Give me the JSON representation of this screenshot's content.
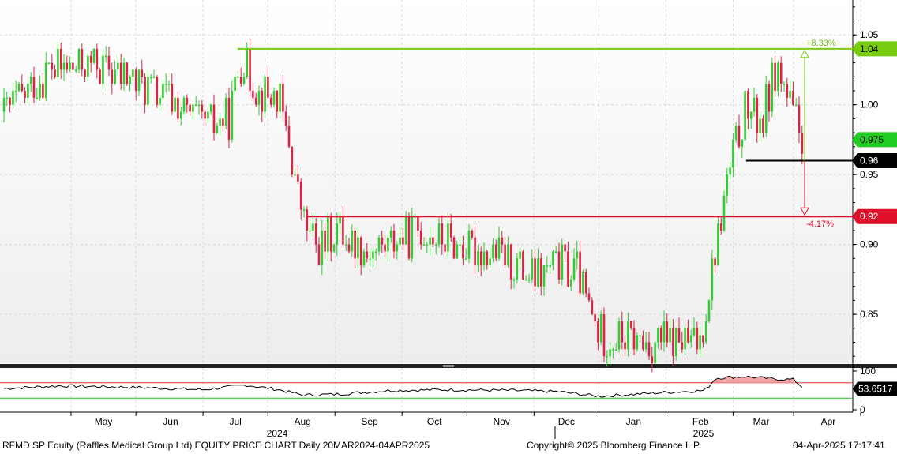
{
  "footer": {
    "left": "RFMD SP Equity (Raffles Medical Group Ltd) EQUITY PRICE CHART  Daily 20MAR2024-04APR2025",
    "center": "Copyright© 2025 Bloomberg Finance L.P.",
    "right": "04-Apr-2025 17:17:41"
  },
  "colors": {
    "up": "#33cc33",
    "down": "#dd2244",
    "high_line": "#77cc11",
    "low_line": "#dd1133",
    "last_line": "#000000",
    "rsi_line": "#000000",
    "rsi_upper": "#dd3333",
    "rsi_lower": "#22bb22",
    "rsi_fill": "#f4a6a6"
  },
  "chart_data": [
    {
      "type": "candlestick",
      "title": "",
      "date_range": [
        "2024-03-20",
        "2025-04-04"
      ],
      "x_month_labels": [
        "May",
        "Jun",
        "Jul",
        "Aug",
        "Sep",
        "Oct",
        "Nov",
        "Dec",
        "Jan",
        "Feb",
        "Mar",
        "Apr"
      ],
      "x_year_labels": [
        "2024",
        "2025"
      ],
      "y_ticks": [
        0.85,
        0.9,
        0.95,
        1.0,
        1.05
      ],
      "ylim": [
        0.815,
        1.075
      ],
      "price_path": [
        [
          "2024-03-20",
          0.995
        ],
        [
          "2024-04-10",
          1.025
        ],
        [
          "2024-05-01",
          1.03
        ],
        [
          "2024-05-20",
          1.015
        ],
        [
          "2024-06-05",
          1.005
        ],
        [
          "2024-06-20",
          0.985
        ],
        [
          "2024-07-02",
          0.99
        ],
        [
          "2024-07-08",
          1.035
        ],
        [
          "2024-07-15",
          1.01
        ],
        [
          "2024-07-25",
          1.005
        ],
        [
          "2024-07-30",
          0.97
        ],
        [
          "2024-08-05",
          0.92
        ],
        [
          "2024-08-12",
          0.895
        ],
        [
          "2024-08-20",
          0.91
        ],
        [
          "2024-09-05",
          0.895
        ],
        [
          "2024-09-20",
          0.905
        ],
        [
          "2024-10-01",
          0.91
        ],
        [
          "2024-10-15",
          0.9
        ],
        [
          "2024-11-01",
          0.895
        ],
        [
          "2024-11-20",
          0.875
        ],
        [
          "2024-12-02",
          0.885
        ],
        [
          "2024-12-10",
          0.88
        ],
        [
          "2024-12-20",
          0.835
        ],
        [
          "2025-01-10",
          0.83
        ],
        [
          "2025-02-05",
          0.83
        ],
        [
          "2025-02-10",
          0.88
        ],
        [
          "2025-02-18",
          0.95
        ],
        [
          "2025-02-25",
          0.995
        ],
        [
          "2025-03-06",
          0.99
        ],
        [
          "2025-03-12",
          1.03
        ],
        [
          "2025-03-20",
          0.99
        ],
        [
          "2025-03-25",
          0.975
        ]
      ],
      "levels": [
        {
          "label": "1.04",
          "value": 1.04,
          "type": "high",
          "pct": "+8.33%"
        },
        {
          "label": "0.975",
          "value": 0.975,
          "type": "last"
        },
        {
          "label": "0.96",
          "value": 0.96,
          "type": "reference"
        },
        {
          "label": "0.92",
          "value": 0.92,
          "type": "low",
          "pct": "-4.17%"
        }
      ]
    },
    {
      "type": "line",
      "name": "RSI",
      "y_ticks": [
        0,
        100
      ],
      "ylim": [
        0,
        100
      ],
      "thresholds": [
        70,
        30
      ],
      "last_value": "53.6517",
      "series_path": [
        [
          "2024-03-20",
          55
        ],
        [
          "2024-04-15",
          62
        ],
        [
          "2024-05-20",
          58
        ],
        [
          "2024-06-20",
          52
        ],
        [
          "2024-07-10",
          64
        ],
        [
          "2024-07-25",
          52
        ],
        [
          "2024-08-05",
          38
        ],
        [
          "2024-08-20",
          40
        ],
        [
          "2024-09-15",
          50
        ],
        [
          "2024-10-10",
          52
        ],
        [
          "2024-11-10",
          50
        ],
        [
          "2024-12-01",
          47
        ],
        [
          "2024-12-20",
          35
        ],
        [
          "2025-01-20",
          45
        ],
        [
          "2025-02-07",
          50
        ],
        [
          "2025-02-12",
          82
        ],
        [
          "2025-02-25",
          86
        ],
        [
          "2025-03-10",
          80
        ],
        [
          "2025-03-20",
          78
        ],
        [
          "2025-03-25",
          54
        ]
      ]
    }
  ]
}
